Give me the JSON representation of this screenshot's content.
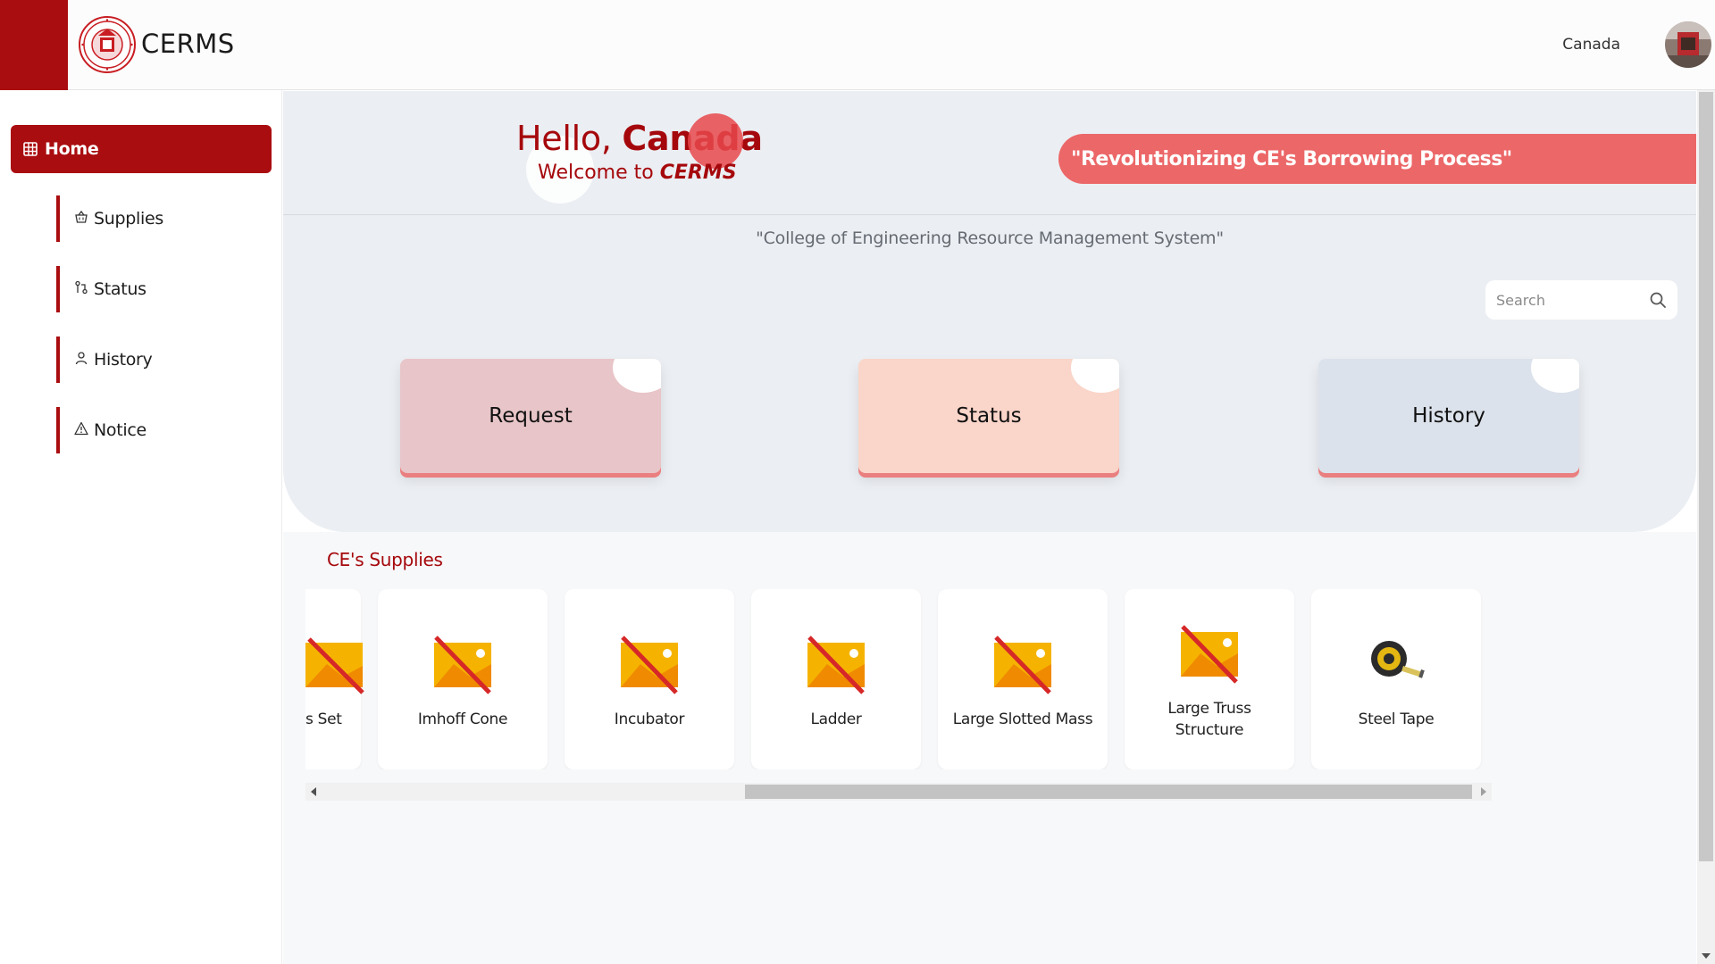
{
  "header": {
    "app_title": "CERMS",
    "user_name": "Canada",
    "logo_icon": "university-seal-logo",
    "avatar_icon": "user-avatar"
  },
  "sidebar": {
    "items": [
      {
        "label": "Home",
        "icon": "grid-icon",
        "active": true
      },
      {
        "label": "Supplies",
        "icon": "basket-icon"
      },
      {
        "label": "Status",
        "icon": "git-compare-icon"
      },
      {
        "label": "History",
        "icon": "user-icon"
      },
      {
        "label": "Notice",
        "icon": "warning-triangle-icon"
      }
    ]
  },
  "hero": {
    "hello_prefix": "Hello, ",
    "hello_name": "Canada",
    "welcome_prefix": "Welcome to ",
    "welcome_app": "CERMS",
    "banner": "\"Revolutionizing CE's Borrowing Process\"",
    "tagline": "\"College of Engineering Resource Management System\""
  },
  "search": {
    "placeholder": "Search",
    "value": ""
  },
  "cards": {
    "request": "Request",
    "status": "Status",
    "history": "History"
  },
  "supplies": {
    "title": "CE's Supplies",
    "items": [
      {
        "label": "s Set",
        "image": "broken-image-icon"
      },
      {
        "label": "Imhoff Cone",
        "image": "broken-image-icon"
      },
      {
        "label": "Incubator",
        "image": "broken-image-icon"
      },
      {
        "label": "Ladder",
        "image": "broken-image-icon"
      },
      {
        "label": "Large Slotted Mass",
        "image": "broken-image-icon"
      },
      {
        "label": "Large Truss Structure",
        "image": "broken-image-icon"
      },
      {
        "label": "Steel Tape",
        "image": "tape-measure-icon"
      }
    ]
  },
  "colors": {
    "brand": "#aa0d10",
    "banner": "#ec6768",
    "request_card": "#e8c5c8",
    "status_card": "#fad5c9",
    "history_card": "#dce2eb"
  }
}
